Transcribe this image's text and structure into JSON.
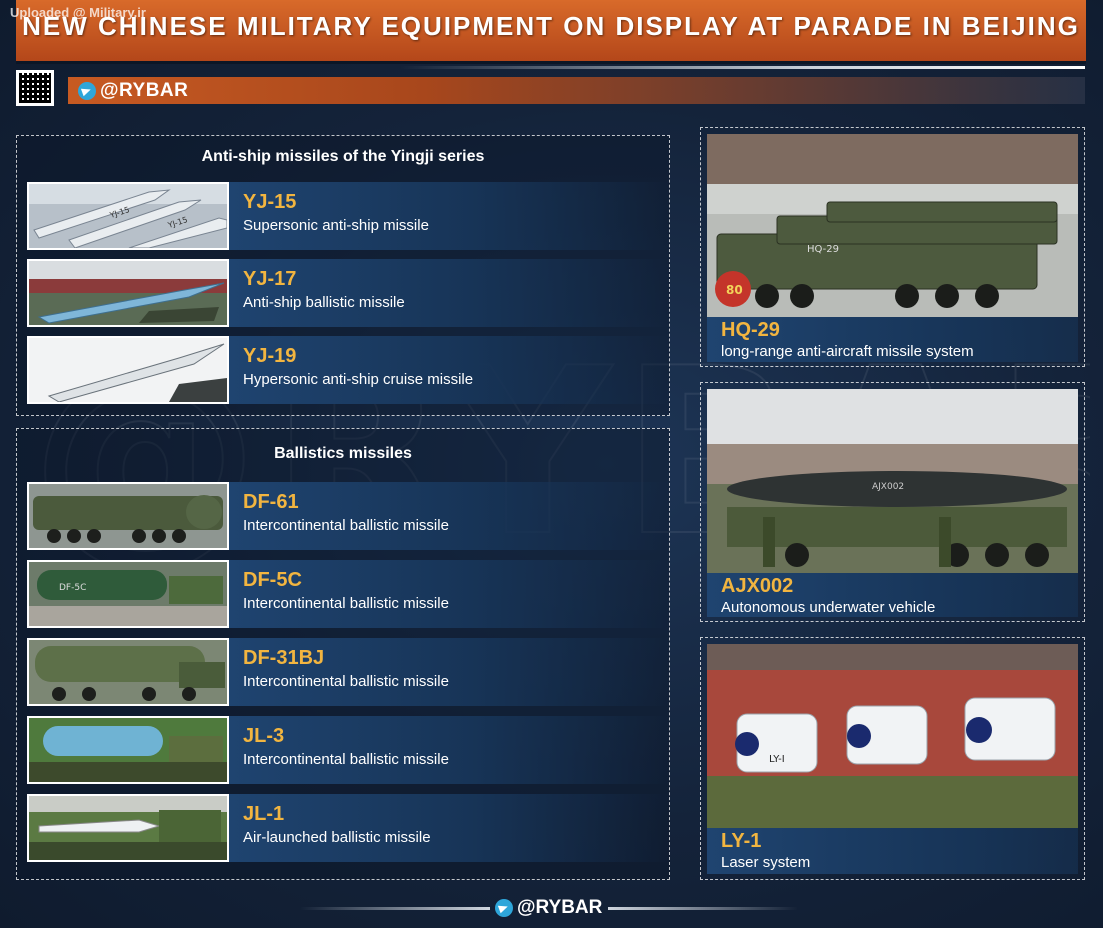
{
  "watermark_text": "",
  "uploaded_label": "Uploaded @ Military.ir",
  "title": "NEW CHINESE MILITARY EQUIPMENT ON DISPLAY AT PARADE IN BEIJING",
  "brand": {
    "handle": "@RYBAR",
    "icon": "telegram-icon"
  },
  "colors": {
    "accent_orange": "#c75a22",
    "code_yellow": "#f2b540",
    "panel_blue": "#1f4470",
    "background": "#14233a"
  },
  "left_panels": [
    {
      "title": "Anti-ship missiles of the Yingji series",
      "items": [
        {
          "code": "YJ-15",
          "description": "Supersonic anti-ship missile"
        },
        {
          "code": "YJ-17",
          "description": "Anti-ship ballistic missile"
        },
        {
          "code": "YJ-19",
          "description": "Hypersonic anti-ship cruise missile"
        }
      ]
    },
    {
      "title": "Ballistics missiles",
      "items": [
        {
          "code": "DF-61",
          "description": "Intercontinental ballistic missile"
        },
        {
          "code": "DF-5C",
          "description": "Intercontinental ballistic missile"
        },
        {
          "code": "DF-31BJ",
          "description": "Intercontinental ballistic missile"
        },
        {
          "code": "JL-3",
          "description": "Intercontinental ballistic missile"
        },
        {
          "code": "JL-1",
          "description": "Air-launched ballistic missile"
        }
      ]
    }
  ],
  "right_panels": [
    {
      "code": "HQ-29",
      "description": "long-range anti-aircraft missile system",
      "photo_label": "HQ-29",
      "badge_text": "80"
    },
    {
      "code": "AJX002",
      "description": "Autonomous underwater vehicle",
      "photo_label": "AJX002"
    },
    {
      "code": "LY-1",
      "description": "Laser system",
      "photo_label": "LY-I"
    }
  ],
  "footer": {
    "handle": "@RYBAR",
    "icon": "telegram-icon"
  }
}
